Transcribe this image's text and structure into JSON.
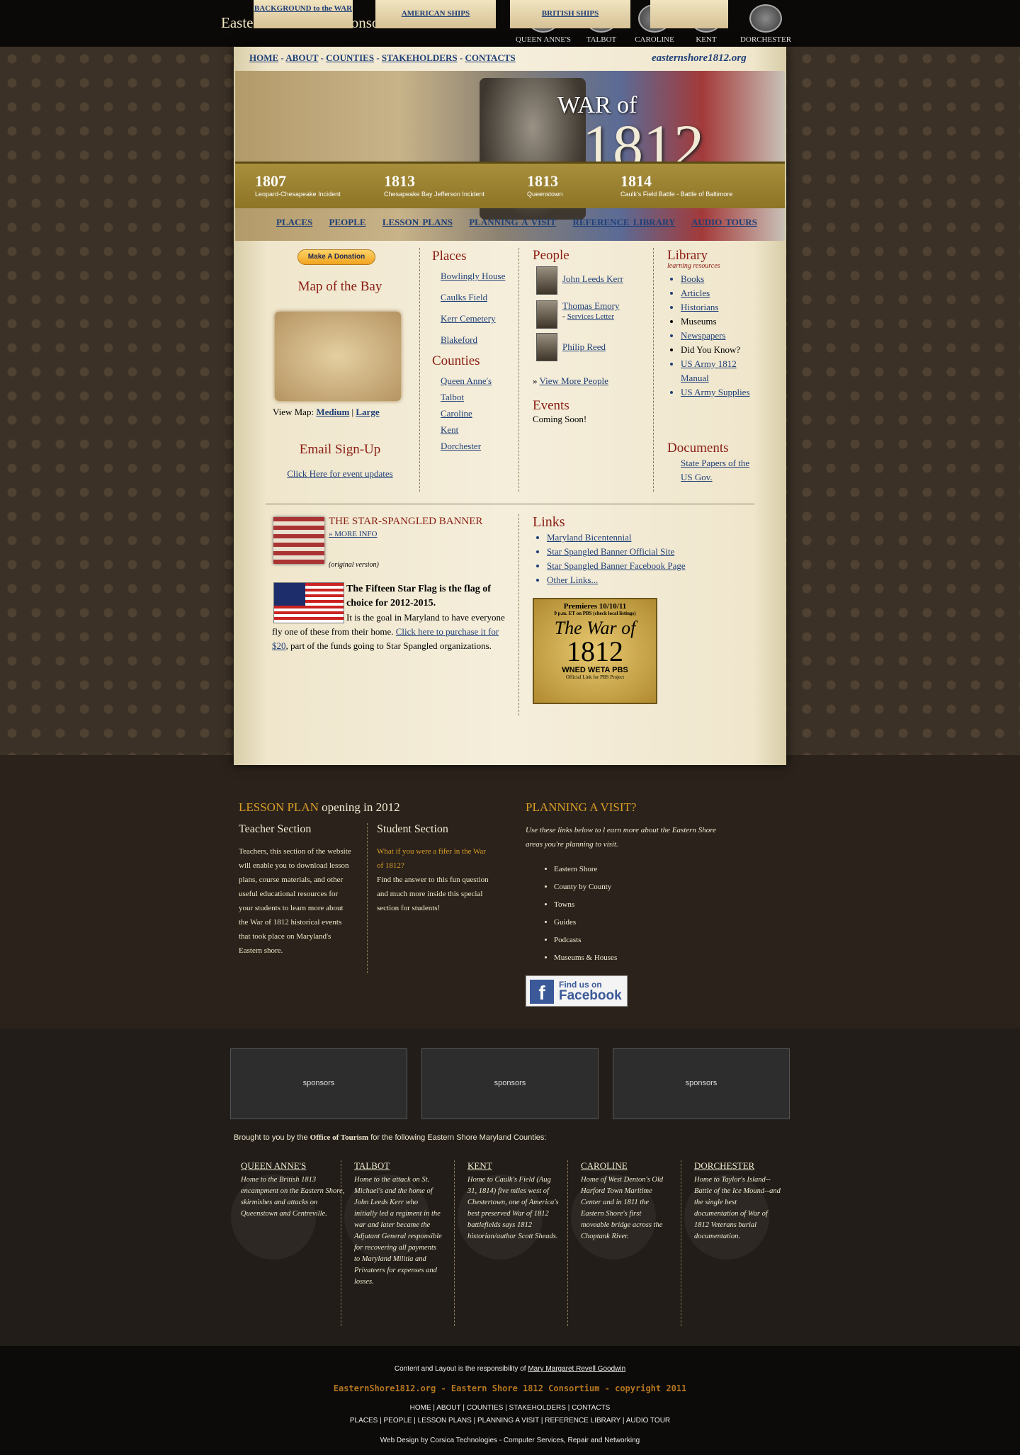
{
  "site": {
    "title": "Eastern Shore 1812 Consortium",
    "url": "easternshore1812.org"
  },
  "seals": [
    "QUEEN ANNE'S",
    "TALBOT",
    "CAROLINE",
    "KENT",
    "DORCHESTER"
  ],
  "topnav": [
    "HOME",
    "ABOUT",
    "COUNTIES",
    "STAKEHOLDERS",
    "CONTACTS"
  ],
  "banner": {
    "war_of": "WAR of",
    "year": "1812"
  },
  "timeline": [
    {
      "year": "1807",
      "label": "Leopard-Chesapeake Incident"
    },
    {
      "year": "1813",
      "label": "Chesapeake Bay Jefferson Incident"
    },
    {
      "year": "1813",
      "label": "Queenstown"
    },
    {
      "year": "1814",
      "label": "Caulk's Field Battle - Battle of Baltimore"
    }
  ],
  "subnav": [
    "PLACES",
    "PEOPLE",
    "LESSON PLANS",
    "PLANNING A VISIT",
    "REFERENCE LIBRARY",
    "AUDIO TOURS"
  ],
  "donate": "Make A Donation",
  "map": {
    "heading": "Map of the Bay",
    "view_label": "View Map:",
    "medium": "Medium",
    "sep": "|",
    "large": "Large"
  },
  "email": {
    "heading": "Email Sign-Up",
    "link": "Click Here for event updates"
  },
  "places": {
    "heading": "Places",
    "items": [
      "Bowlingly House",
      "Caulks Field",
      "Kerr Cemetery",
      "Blakeford"
    ]
  },
  "counties": {
    "heading": "Counties",
    "items": [
      "Queen Anne's",
      "Talbot",
      "Caroline",
      "Kent",
      "Dorchester"
    ]
  },
  "people": {
    "heading": "People",
    "items": [
      {
        "name": "John Leeds Kerr"
      },
      {
        "name": "Thomas Emory",
        "sub": "Services Letter"
      },
      {
        "name": "Philip Reed"
      }
    ],
    "more": "View More People"
  },
  "events": {
    "heading": "Events",
    "text": "Coming Soon!"
  },
  "library": {
    "heading": "Library",
    "sub": "learning resources",
    "items": [
      {
        "label": "Books",
        "link": true
      },
      {
        "label": "Articles",
        "link": true
      },
      {
        "label": "Historians",
        "link": true
      },
      {
        "label": "Museums",
        "link": false
      },
      {
        "label": "Newspapers",
        "link": true
      },
      {
        "label": "Did You Know?",
        "link": false
      },
      {
        "label": "US Army 1812 Manual",
        "link": true
      },
      {
        "label": "US Army Supplies",
        "link": true
      }
    ]
  },
  "documents": {
    "heading": "Documents",
    "link": "State Papers of the US Gov."
  },
  "banner_flag": {
    "title": "THE STAR-SPANGLED BANNER",
    "more": "» MORE INFO",
    "caption": "(original version)"
  },
  "fifteen": {
    "bold": "The Fifteen Star Flag is the flag of choice for 2012-2015.",
    "text1": "It is the goal in Maryland to have everyone fly one of these from their home.",
    "link": "Click here to purchase it for $20",
    "text2": ", part of the funds going to Star Spangled organizations."
  },
  "links": {
    "heading": "Links",
    "items": [
      "Maryland Bicentennial",
      "Star Spangled Banner Official Site",
      "Star Spangled Banner Facebook Page",
      "Other Links..."
    ]
  },
  "pbs": {
    "premiere": "Premieres 10/10/11",
    "sub": "9 p.m. ET on PBS (check local listings)",
    "title": "The War of",
    "year": "1812",
    "logos": "WNED  WETA  PBS",
    "footer": "Official Link for PBS Project"
  },
  "tabs": [
    "BACKGROUND to the WAR",
    "AMERICAN SHIPS",
    "BRITISH SHIPS"
  ],
  "lesson": {
    "heading1": "LESSON PLAN",
    "heading2": " opening in 2012",
    "teacher_h": "Teacher Section",
    "teacher_text": "Teachers, this section of the website will enable you to download lesson plans, course materials, and other useful educational resources for your students to learn more about the War of 1812 historical events that took place on Maryland's Eastern shore.",
    "student_h": "Student Section",
    "student_q": "What if you were a fifer in the War of 1812?",
    "student_text": "Find the answer to this fun question and much more inside this special section for students!"
  },
  "visit": {
    "heading": "PLANNING A VISIT?",
    "intro": "Use these links below to l earn more about the Eastern Shore areas you're planning to visit.",
    "items": [
      "Eastern Shore",
      "County by County",
      "Towns",
      "Guides",
      "Podcasts",
      "Museums & Houses"
    ]
  },
  "facebook": {
    "line1": "Find us on",
    "line2": "Facebook"
  },
  "sponsors": [
    "sponsors",
    "sponsors",
    "sponsors"
  ],
  "brought": {
    "pre": "Brought to you by the ",
    "bold": "Office of Tourism",
    "post": " for the following Eastern Shore Maryland Counties:"
  },
  "county_cols": [
    {
      "name": "QUEEN ANNE'S",
      "text": "Home to the British 1813 encampment on the Eastern Shore, skirmishes and attacks on Queenstown and Centreville."
    },
    {
      "name": "TALBOT",
      "text": "Home to the attack on St. Michael's and the home of John Leeds Kerr who initially led a regiment in the war and later became the Adjutant General responsible for recovering all payments to Maryland Militia and Privateers for expenses and losses."
    },
    {
      "name": "KENT",
      "text": "Home to Caulk's Field (Aug 31, 1814) five miles west of Chestertown, one of America's best preserved War of 1812 battlefields says 1812 historian/author Scott Sheads."
    },
    {
      "name": "CAROLINE",
      "text": "Home of West Denton's Old Harford Town Maritime Center and in 1811 the Eastern Shore's first moveable bridge across the Choptank River."
    },
    {
      "name": "DORCHESTER",
      "text": "Home to Taylor's Island--Battle of the Ice Mound--and the single best documentation of War of 1812 Veterans burial documentation."
    }
  ],
  "footer": {
    "resp_pre": "Content and Layout is the responsibility of ",
    "resp_name": "Mary Margaret Revell Goodwin",
    "copyright": "EasternShore1812.org - Eastern Shore 1812 Consortium - copyright 2011",
    "nav1": [
      "HOME",
      "ABOUT",
      "COUNTIES",
      "STAKEHOLDERS",
      "CONTACTS"
    ],
    "nav2": [
      "PLACES",
      "PEOPLE",
      "LESSON PLANS",
      "PLANNING A VISIT",
      "REFERENCE LIBRARY",
      "AUDIO TOUR"
    ],
    "design": "Web Design by Corsica Technologies - Computer Services, Repair and Networking"
  }
}
